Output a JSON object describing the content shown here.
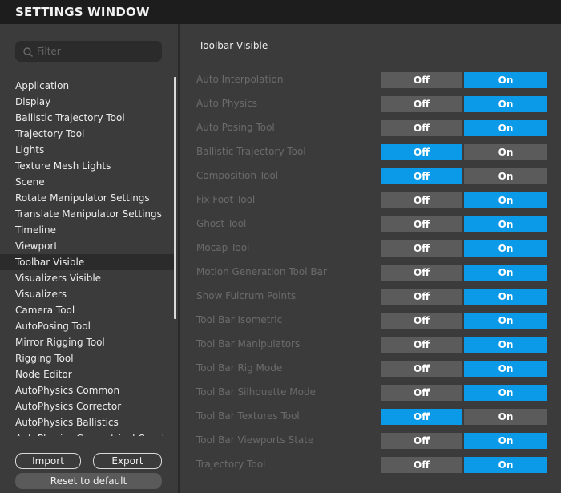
{
  "window": {
    "title": "SETTINGS WINDOW"
  },
  "search": {
    "placeholder": "Filter",
    "value": ""
  },
  "colors": {
    "accent": "#0a9ae8",
    "inactive_segment": "#5b5b5b",
    "panel": "#3b3b3b",
    "titlebar": "#1d1d1d"
  },
  "sidebar": {
    "items": [
      {
        "label": "Application"
      },
      {
        "label": "Display"
      },
      {
        "label": "Ballistic Trajectory Tool"
      },
      {
        "label": "Trajectory Tool"
      },
      {
        "label": "Lights"
      },
      {
        "label": "Texture Mesh Lights"
      },
      {
        "label": "Scene"
      },
      {
        "label": "Rotate Manipulator Settings"
      },
      {
        "label": "Translate Manipulator Settings"
      },
      {
        "label": "Timeline"
      },
      {
        "label": "Viewport"
      },
      {
        "label": "Toolbar Visible",
        "selected": true
      },
      {
        "label": "Visualizers Visible"
      },
      {
        "label": "Visualizers"
      },
      {
        "label": "Camera Tool"
      },
      {
        "label": "AutoPosing Tool"
      },
      {
        "label": "Mirror Rigging Tool"
      },
      {
        "label": "Rigging Tool"
      },
      {
        "label": "Node Editor"
      },
      {
        "label": "AutoPhysics Common"
      },
      {
        "label": "AutoPhysics Corrector"
      },
      {
        "label": "AutoPhysics Ballistics"
      },
      {
        "label": "AutoPhysics Geometrical Const"
      }
    ],
    "import_label": "Import",
    "export_label": "Export",
    "reset_label": "Reset to default"
  },
  "main": {
    "section_title": "Toolbar Visible",
    "off_label": "Off",
    "on_label": "On",
    "rows": [
      {
        "label": "Auto Interpolation",
        "value": "On"
      },
      {
        "label": "Auto Physics",
        "value": "On"
      },
      {
        "label": "Auto Posing Tool",
        "value": "On"
      },
      {
        "label": "Ballistic Trajectory Tool",
        "value": "Off"
      },
      {
        "label": "Composition Tool",
        "value": "Off"
      },
      {
        "label": "Fix Foot Tool",
        "value": "On"
      },
      {
        "label": "Ghost Tool",
        "value": "On"
      },
      {
        "label": "Mocap Tool",
        "value": "On"
      },
      {
        "label": "Motion Generation Tool Bar",
        "value": "On"
      },
      {
        "label": "Show Fulcrum Points",
        "value": "On"
      },
      {
        "label": "Tool Bar Isometric",
        "value": "On"
      },
      {
        "label": "Tool Bar Manipulators",
        "value": "On"
      },
      {
        "label": "Tool Bar Rig Mode",
        "value": "On"
      },
      {
        "label": "Tool Bar Silhouette Mode",
        "value": "On"
      },
      {
        "label": "Tool Bar Textures Tool",
        "value": "Off"
      },
      {
        "label": "Tool Bar Viewports State",
        "value": "On"
      },
      {
        "label": "Trajectory Tool",
        "value": "On"
      }
    ]
  }
}
